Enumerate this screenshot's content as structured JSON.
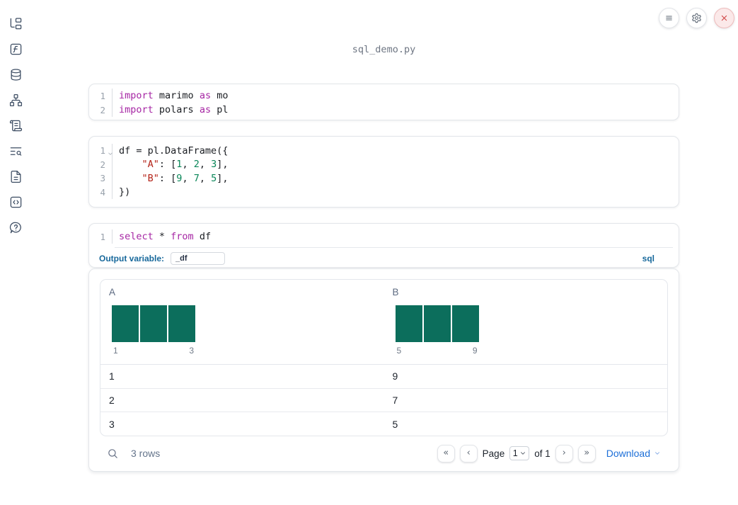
{
  "window": {
    "title": "sql_demo.py"
  },
  "topbar": {
    "icons": [
      "hamburger-icon",
      "gear-icon",
      "close-icon"
    ]
  },
  "sidebar": {
    "icons": [
      "file-tree-icon",
      "function-square-icon",
      "database-icon",
      "network-icon",
      "scroll-icon",
      "text-search-icon",
      "file-text-icon",
      "code-square-icon",
      "help-bubble-icon"
    ]
  },
  "cells": [
    {
      "lines": [
        {
          "n": "1",
          "tokens": [
            {
              "t": "import"
            },
            {
              "t": " marimo "
            },
            {
              "t": "as"
            },
            {
              "t": " mo"
            }
          ]
        },
        {
          "n": "2",
          "tokens": [
            {
              "t": "import"
            },
            {
              "t": " polars "
            },
            {
              "t": "as"
            },
            {
              "t": " pl"
            }
          ]
        }
      ]
    },
    {
      "lines": [
        {
          "n": "1",
          "tokens": [
            {
              "t": "df = pl.DataFrame({"
            }
          ]
        },
        {
          "n": "2",
          "tokens": [
            {
              "t": "    "
            },
            {
              "t": "\"A\""
            },
            {
              "t": ": ["
            },
            {
              "t": "1"
            },
            {
              "t": ", "
            },
            {
              "t": "2"
            },
            {
              "t": ", "
            },
            {
              "t": "3"
            },
            {
              "t": "],"
            }
          ]
        },
        {
          "n": "3",
          "tokens": [
            {
              "t": "    "
            },
            {
              "t": "\"B\""
            },
            {
              "t": ": ["
            },
            {
              "t": "9"
            },
            {
              "t": ", "
            },
            {
              "t": "7"
            },
            {
              "t": ", "
            },
            {
              "t": "5"
            },
            {
              "t": "],"
            }
          ]
        },
        {
          "n": "4",
          "tokens": [
            {
              "t": "})"
            }
          ]
        }
      ]
    },
    {
      "lines": [
        {
          "n": "1",
          "tokens": [
            {
              "t": "select"
            },
            {
              "t": " * "
            },
            {
              "t": "from"
            },
            {
              "t": " df"
            }
          ]
        }
      ],
      "output_variable_label": "Output variable:",
      "output_variable_value": "_df",
      "language_badge": "sql"
    }
  ],
  "table": {
    "columns": [
      {
        "header": "A",
        "hist": {
          "bars": [
            1,
            1,
            1
          ],
          "min_label": "1",
          "max_label": "3"
        }
      },
      {
        "header": "B",
        "hist": {
          "bars": [
            1,
            1,
            1
          ],
          "min_label": "5",
          "max_label": "9"
        }
      }
    ],
    "rows": [
      [
        "1",
        "9"
      ],
      [
        "2",
        "7"
      ],
      [
        "3",
        "5"
      ]
    ],
    "footer": {
      "row_count": "3 rows",
      "page_label": "Page",
      "page_value": "1",
      "page_of": "of 1",
      "download_label": "Download"
    },
    "pagination_icons": {
      "first": "«",
      "prev": "‹",
      "next": "›",
      "last": "»"
    }
  },
  "colors": {
    "keyword": "#a626a4",
    "string": "#b42318",
    "number": "#098658",
    "histogram_bar": "#0c6e5c",
    "sql_accent": "#17689b",
    "download_link": "#1d6fd8",
    "close_accent": "#d04444",
    "sidebar_icon": "#3d4d63"
  }
}
